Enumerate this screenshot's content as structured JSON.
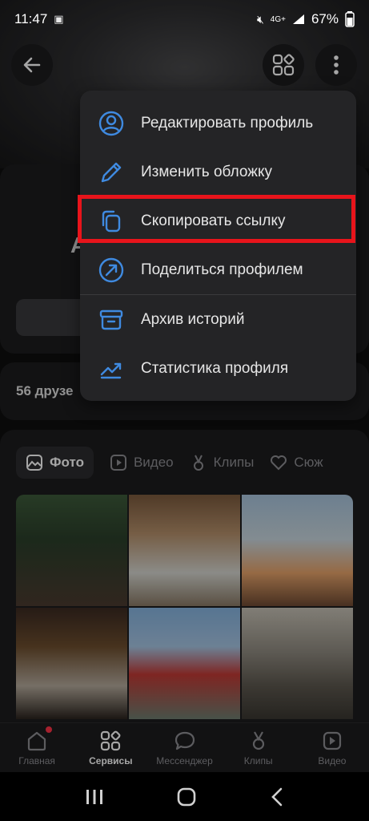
{
  "status_bar": {
    "time": "11:47",
    "network": "4G+",
    "battery": "67%"
  },
  "profile": {
    "initial": "А",
    "friends_text": "56 друзе"
  },
  "menu": {
    "items": [
      {
        "label": "Редактировать профиль",
        "icon": "user-circle-icon"
      },
      {
        "label": "Изменить обложку",
        "icon": "pencil-icon"
      },
      {
        "label": "Скопировать ссылку",
        "icon": "copy-icon",
        "highlighted": true
      },
      {
        "label": "Поделиться профилем",
        "icon": "share-arrow-icon"
      },
      {
        "label": "Архив историй",
        "icon": "archive-icon"
      },
      {
        "label": "Статистика профиля",
        "icon": "stats-icon"
      }
    ],
    "highlight_color": "#e8141b",
    "icon_color": "#3f8ae0"
  },
  "tabs": [
    {
      "label": "Фото",
      "active": true
    },
    {
      "label": "Видео",
      "active": false
    },
    {
      "label": "Клипы",
      "active": false
    },
    {
      "label": "Сюж",
      "active": false
    }
  ],
  "bottom_nav": [
    {
      "label": "Главная",
      "active": false,
      "badge": true
    },
    {
      "label": "Сервисы",
      "active": true,
      "badge": false
    },
    {
      "label": "Мессенджер",
      "active": false,
      "badge": false
    },
    {
      "label": "Клипы",
      "active": false,
      "badge": false
    },
    {
      "label": "Видео",
      "active": false,
      "badge": false
    }
  ]
}
